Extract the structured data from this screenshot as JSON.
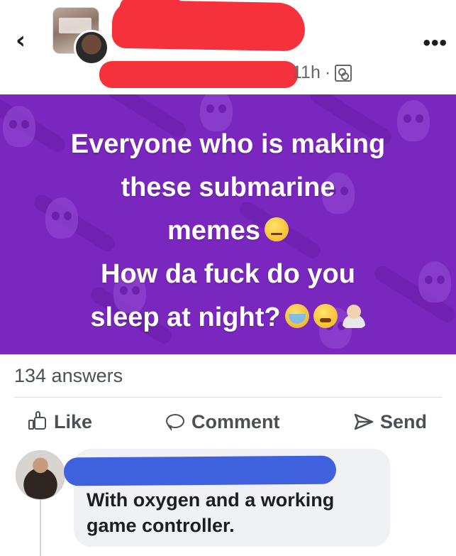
{
  "header": {
    "back_glyph": "‹",
    "time": "11h",
    "separator": "·",
    "more_glyph": "•••",
    "privacy_icon": "people-icon",
    "redaction_colors": {
      "name": "#f5323c",
      "commenter": "#3f61dd"
    }
  },
  "post": {
    "background_color": "#7a27bf",
    "lines": [
      "Everyone who is making",
      "these submarine",
      "memes",
      "How da fuck do you",
      "sleep at night?"
    ],
    "emojis": [
      "raised-eyebrow-emoji",
      "crying-emoji",
      "steam-face-emoji",
      "facepalm-emoji"
    ]
  },
  "stats": {
    "answers": "134 answers"
  },
  "actions": {
    "like": "Like",
    "comment": "Comment",
    "send": "Send"
  },
  "comment": {
    "text": "With oxygen and a working game controller."
  }
}
